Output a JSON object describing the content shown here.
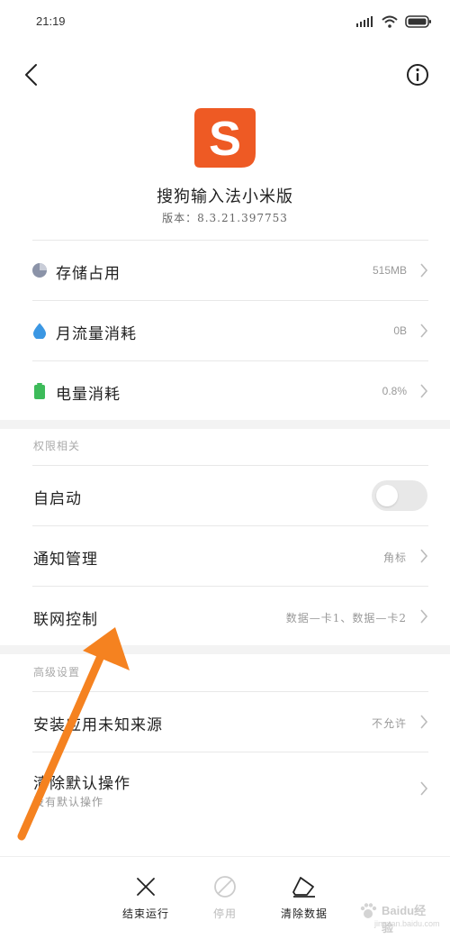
{
  "status_bar": {
    "time": "21:19"
  },
  "app": {
    "name": "搜狗输入法小米版",
    "version": "版本：8.3.21.397753",
    "icon_letter": "S"
  },
  "usage_rows": [
    {
      "label": "存储占用",
      "value": "515MB",
      "icon": "pie-chart-icon"
    },
    {
      "label": "月流量消耗",
      "value": "0B",
      "icon": "water-drop-icon"
    },
    {
      "label": "电量消耗",
      "value": "0.8%",
      "icon": "battery-icon"
    }
  ],
  "permissions": {
    "title": "权限相关",
    "autostart": {
      "label": "自启动",
      "enabled": false
    },
    "notifications": {
      "label": "通知管理",
      "value": "角标"
    },
    "network": {
      "label": "联网控制",
      "value": "数据—卡1、数据—卡2"
    }
  },
  "advanced": {
    "title": "高级设置",
    "unknown_sources": {
      "label": "安装应用未知来源",
      "value": "不允许"
    },
    "clear_defaults": {
      "label": "清除默认操作",
      "sub": "没有默认操作"
    }
  },
  "actions": [
    {
      "label": "结束运行",
      "icon": "close-icon",
      "enabled": true
    },
    {
      "label": "停用",
      "icon": "disable-icon",
      "enabled": false
    },
    {
      "label": "清除数据",
      "icon": "eraser-icon",
      "enabled": true
    }
  ],
  "watermark": {
    "text": "Baidu经验",
    "sub": "jingyan.baidu.com"
  },
  "colors": {
    "accent_orange": "#ee5a24",
    "arrow_orange": "#f58220",
    "drop_blue": "#3b97e3",
    "battery_green": "#3dbb5a",
    "pie_gray": "#8b93a8"
  }
}
